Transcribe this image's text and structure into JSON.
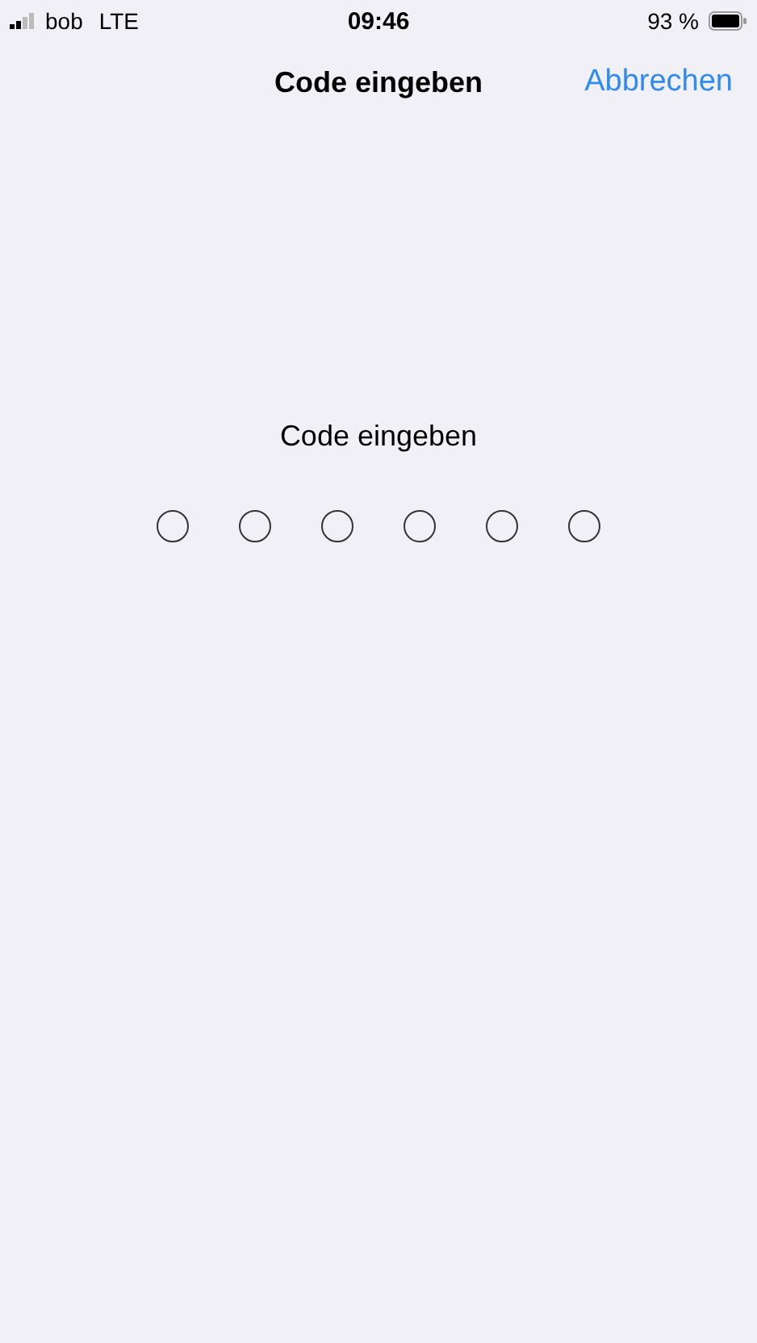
{
  "status_bar": {
    "carrier": "bob",
    "network": "LTE",
    "time": "09:46",
    "battery": "93 %"
  },
  "nav_bar": {
    "title": "Code eingeben",
    "action": "Abbrechen"
  },
  "prompt": "Code eingeben",
  "code_digits": [
    {
      "filled": false
    },
    {
      "filled": false
    },
    {
      "filled": false
    },
    {
      "filled": false
    },
    {
      "filled": false
    },
    {
      "filled": false
    }
  ]
}
